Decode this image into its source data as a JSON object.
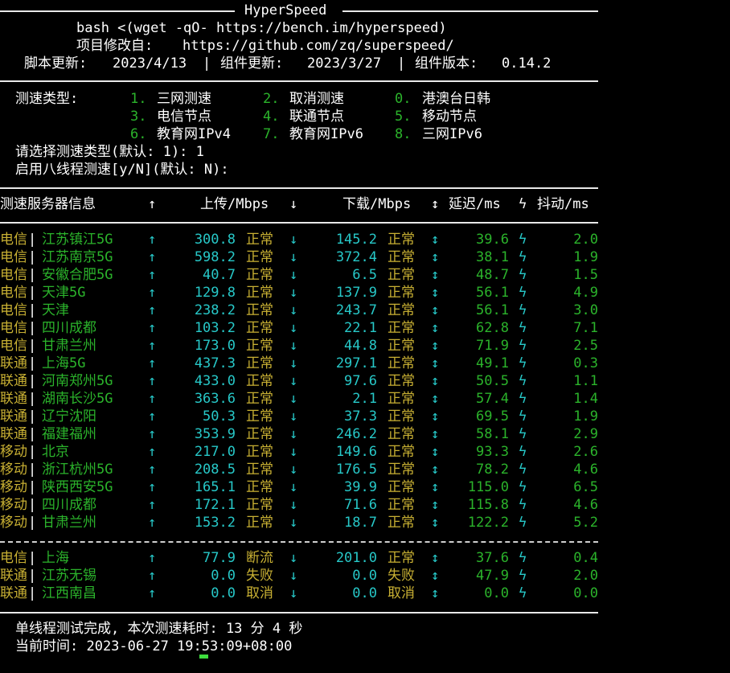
{
  "header": {
    "title": "HyperSpeed",
    "command": "bash <(wget -qO- https://bench.im/hyperspeed)",
    "project_label": "项目修改自:",
    "project_url": "https://github.com/zq/superspeed/",
    "script_update_label": "脚本更新:",
    "script_update": "2023/4/13",
    "component_update_label": "组件更新:",
    "component_update": "2023/3/27",
    "component_version_label": "组件版本:",
    "component_version": "0.14.2",
    "sep": "|"
  },
  "menu": {
    "label": "测速类型:",
    "options": [
      {
        "key": "1.",
        "label": "三网测速"
      },
      {
        "key": "2.",
        "label": "取消测速"
      },
      {
        "key": "0.",
        "label": "港澳台日韩"
      },
      {
        "key": "3.",
        "label": "电信节点"
      },
      {
        "key": "4.",
        "label": "联通节点"
      },
      {
        "key": "5.",
        "label": "移动节点"
      },
      {
        "key": "6.",
        "label": "教育网IPv4"
      },
      {
        "key": "7.",
        "label": "教育网IPv6"
      },
      {
        "key": "8.",
        "label": "三网IPv6"
      }
    ],
    "prompt_type": "请选择测速类型(默认: 1): 1",
    "prompt_threads": "启用八线程测速[y/N](默认: N):"
  },
  "table": {
    "headers": {
      "server": "测速服务器信息",
      "up_arrow": "↑",
      "upload": "上传/Mbps",
      "down_arrow": "↓",
      "download": "下载/Mbps",
      "updown_arrow": "↕",
      "latency": "延迟/ms",
      "bolt": "ϟ",
      "jitter": "抖动/ms"
    },
    "symbols": {
      "up": "↑",
      "down": "↓",
      "updown": "↕",
      "bolt": "ϟ",
      "bar": "|"
    },
    "rows": [
      {
        "isp": "电信",
        "node": "江苏镇江5G",
        "upload": "300.8",
        "up_status": "正常",
        "download": "145.2",
        "down_status": "正常",
        "latency": "39.6",
        "jitter": "2.0"
      },
      {
        "isp": "电信",
        "node": "江苏南京5G",
        "upload": "598.2",
        "up_status": "正常",
        "download": "372.4",
        "down_status": "正常",
        "latency": "38.1",
        "jitter": "1.9"
      },
      {
        "isp": "电信",
        "node": "安徽合肥5G",
        "upload": "40.7",
        "up_status": "正常",
        "download": "6.5",
        "down_status": "正常",
        "latency": "48.7",
        "jitter": "1.5"
      },
      {
        "isp": "电信",
        "node": "天津5G",
        "upload": "129.8",
        "up_status": "正常",
        "download": "137.9",
        "down_status": "正常",
        "latency": "56.1",
        "jitter": "4.9"
      },
      {
        "isp": "电信",
        "node": "天津",
        "upload": "238.2",
        "up_status": "正常",
        "download": "243.7",
        "down_status": "正常",
        "latency": "56.1",
        "jitter": "3.0"
      },
      {
        "isp": "电信",
        "node": "四川成都",
        "upload": "103.2",
        "up_status": "正常",
        "download": "22.1",
        "down_status": "正常",
        "latency": "62.8",
        "jitter": "7.1"
      },
      {
        "isp": "电信",
        "node": "甘肃兰州",
        "upload": "173.0",
        "up_status": "正常",
        "download": "44.8",
        "down_status": "正常",
        "latency": "71.9",
        "jitter": "2.5"
      },
      {
        "isp": "联通",
        "node": "上海5G",
        "upload": "437.3",
        "up_status": "正常",
        "download": "297.1",
        "down_status": "正常",
        "latency": "49.1",
        "jitter": "0.3"
      },
      {
        "isp": "联通",
        "node": "河南郑州5G",
        "upload": "433.0",
        "up_status": "正常",
        "download": "97.6",
        "down_status": "正常",
        "latency": "50.5",
        "jitter": "1.1"
      },
      {
        "isp": "联通",
        "node": "湖南长沙5G",
        "upload": "363.6",
        "up_status": "正常",
        "download": "2.1",
        "down_status": "正常",
        "latency": "57.4",
        "jitter": "1.4"
      },
      {
        "isp": "联通",
        "node": "辽宁沈阳",
        "upload": "50.3",
        "up_status": "正常",
        "download": "37.3",
        "down_status": "正常",
        "latency": "69.5",
        "jitter": "1.9"
      },
      {
        "isp": "联通",
        "node": "福建福州",
        "upload": "353.9",
        "up_status": "正常",
        "download": "246.2",
        "down_status": "正常",
        "latency": "58.1",
        "jitter": "2.9"
      },
      {
        "isp": "移动",
        "node": "北京",
        "upload": "217.0",
        "up_status": "正常",
        "download": "149.6",
        "down_status": "正常",
        "latency": "93.3",
        "jitter": "2.6"
      },
      {
        "isp": "移动",
        "node": "浙江杭州5G",
        "upload": "208.5",
        "up_status": "正常",
        "download": "176.5",
        "down_status": "正常",
        "latency": "78.2",
        "jitter": "4.6"
      },
      {
        "isp": "移动",
        "node": "陕西西安5G",
        "upload": "165.1",
        "up_status": "正常",
        "download": "39.9",
        "down_status": "正常",
        "latency": "115.0",
        "jitter": "6.5"
      },
      {
        "isp": "移动",
        "node": "四川成都",
        "upload": "172.1",
        "up_status": "正常",
        "download": "71.6",
        "down_status": "正常",
        "latency": "115.8",
        "jitter": "4.6"
      },
      {
        "isp": "移动",
        "node": "甘肃兰州",
        "upload": "153.2",
        "up_status": "正常",
        "download": "18.7",
        "down_status": "正常",
        "latency": "122.2",
        "jitter": "5.2"
      }
    ],
    "extra_rows": [
      {
        "isp": "电信",
        "node": "上海",
        "upload": "77.9",
        "up_status": "断流",
        "download": "201.0",
        "down_status": "正常",
        "latency": "37.6",
        "jitter": "0.4"
      },
      {
        "isp": "联通",
        "node": "江苏无锡",
        "upload": "0.0",
        "up_status": "失败",
        "download": "0.0",
        "down_status": "失败",
        "latency": "47.9",
        "jitter": "2.0"
      },
      {
        "isp": "联通",
        "node": "江西南昌",
        "upload": "0.0",
        "up_status": "取消",
        "download": "0.0",
        "down_status": "取消",
        "latency": "0.0",
        "jitter": "0.0"
      }
    ]
  },
  "footer": {
    "done": "单线程测试完成, 本次测速耗时: 13 分 4 秒",
    "time": "当前时间: 2023-06-27 19:53:09+08:00"
  }
}
